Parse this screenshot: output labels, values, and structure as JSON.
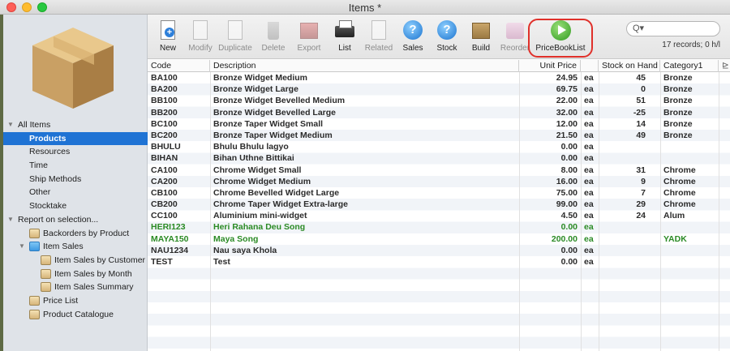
{
  "window": {
    "title": "Items *"
  },
  "sidebar": {
    "items": [
      {
        "label": "All Items",
        "level": 0,
        "tri": "▼",
        "selected": false
      },
      {
        "label": "Products",
        "level": 1,
        "selected": true
      },
      {
        "label": "Resources",
        "level": 1,
        "selected": false
      },
      {
        "label": "Time",
        "level": 1,
        "selected": false
      },
      {
        "label": "Ship Methods",
        "level": 1,
        "selected": false
      },
      {
        "label": "Other",
        "level": 1,
        "selected": false
      },
      {
        "label": "Stocktake",
        "level": 1,
        "selected": false
      },
      {
        "label": "Report on selection...",
        "level": 0,
        "tri": "▼",
        "selected": false
      },
      {
        "label": "Backorders by Product",
        "level": 1,
        "icon": "report-icon"
      },
      {
        "label": "Item Sales",
        "level": 1,
        "tri": "▼",
        "icon": "folder-icon"
      },
      {
        "label": "Item Sales by Customer",
        "level": 2,
        "icon": "report-icon"
      },
      {
        "label": "Item Sales by Month",
        "level": 2,
        "icon": "report-icon"
      },
      {
        "label": "Item Sales Summary",
        "level": 2,
        "icon": "report-icon"
      },
      {
        "label": "Price List",
        "level": 1,
        "icon": "report-icon"
      },
      {
        "label": "Product Catalogue",
        "level": 1,
        "icon": "report-icon"
      }
    ]
  },
  "toolbar": {
    "buttons": [
      {
        "id": "new",
        "label": "New",
        "icon": "new-doc-icon",
        "enabled": true
      },
      {
        "id": "modify",
        "label": "Modify",
        "icon": "pencil-icon",
        "enabled": false
      },
      {
        "id": "duplicate",
        "label": "Duplicate",
        "icon": "duplicate-icon",
        "enabled": false
      },
      {
        "id": "delete",
        "label": "Delete",
        "icon": "trash-icon",
        "enabled": false
      },
      {
        "id": "export",
        "label": "Export",
        "icon": "export-icon",
        "enabled": false
      },
      {
        "id": "list",
        "label": "List",
        "icon": "printer-icon",
        "enabled": true
      },
      {
        "id": "related",
        "label": "Related",
        "icon": "related-icon",
        "enabled": false
      },
      {
        "id": "sales",
        "label": "Sales",
        "icon": "help-icon",
        "enabled": true
      },
      {
        "id": "stock",
        "label": "Stock",
        "icon": "help-icon",
        "enabled": true
      },
      {
        "id": "build",
        "label": "Build",
        "icon": "build-icon",
        "enabled": true
      },
      {
        "id": "reorder",
        "label": "Reorder",
        "icon": "reorder-icon",
        "enabled": false
      },
      {
        "id": "pricebooklist",
        "label": "PriceBookList",
        "icon": "play-icon",
        "enabled": true
      }
    ],
    "search_placeholder": "",
    "search_prefix": "Q▾",
    "records": "17 records; 0 h/l",
    "highlight_color": "#e0302a"
  },
  "table": {
    "columns": [
      "Code",
      "Description",
      "Unit Price",
      "",
      "Stock on Hand",
      "Category1"
    ],
    "rows": [
      {
        "code": "BA100",
        "desc": "Bronze Widget Medium",
        "price": "24.95",
        "unit": "ea",
        "stock": "45",
        "cat": "Bronze"
      },
      {
        "code": "BA200",
        "desc": "Bronze Widget Large",
        "price": "69.75",
        "unit": "ea",
        "stock": "0",
        "cat": "Bronze"
      },
      {
        "code": "BB100",
        "desc": "Bronze Widget Bevelled Medium",
        "price": "22.00",
        "unit": "ea",
        "stock": "51",
        "cat": "Bronze"
      },
      {
        "code": "BB200",
        "desc": "Bronze Widget Bevelled Large",
        "price": "32.00",
        "unit": "ea",
        "stock": "-25",
        "cat": "Bronze"
      },
      {
        "code": "BC100",
        "desc": "Bronze Taper Widget Small",
        "price": "12.00",
        "unit": "ea",
        "stock": "14",
        "cat": "Bronze"
      },
      {
        "code": "BC200",
        "desc": "Bronze Taper Widget Medium",
        "price": "21.50",
        "unit": "ea",
        "stock": "49",
        "cat": "Bronze"
      },
      {
        "code": "BHULU",
        "desc": "Bhulu Bhulu lagyo",
        "price": "0.00",
        "unit": "ea",
        "stock": "",
        "cat": ""
      },
      {
        "code": "BIHAN",
        "desc": "Bihan Uthne Bittikai",
        "price": "0.00",
        "unit": "ea",
        "stock": "",
        "cat": ""
      },
      {
        "code": "CA100",
        "desc": "Chrome Widget Small",
        "price": "8.00",
        "unit": "ea",
        "stock": "31",
        "cat": "Chrome"
      },
      {
        "code": "CA200",
        "desc": "Chrome Widget Medium",
        "price": "16.00",
        "unit": "ea",
        "stock": "9",
        "cat": "Chrome"
      },
      {
        "code": "CB100",
        "desc": "Chrome Bevelled Widget Large",
        "price": "75.00",
        "unit": "ea",
        "stock": "7",
        "cat": "Chrome"
      },
      {
        "code": "CB200",
        "desc": "Chrome Taper Widget Extra-large",
        "price": "99.00",
        "unit": "ea",
        "stock": "29",
        "cat": "Chrome"
      },
      {
        "code": "CC100",
        "desc": "Aluminium mini-widget",
        "price": "4.50",
        "unit": "ea",
        "stock": "24",
        "cat": "Alum"
      },
      {
        "code": "HERI123",
        "desc": "Heri Rahana Deu Song",
        "price": "0.00",
        "unit": "ea",
        "stock": "",
        "cat": "",
        "green": true
      },
      {
        "code": "MAYA150",
        "desc": "Maya Song",
        "price": "200.00",
        "unit": "ea",
        "stock": "",
        "cat": "YADK",
        "green": true
      },
      {
        "code": "NAU1234",
        "desc": "Nau saya Khola",
        "price": "0.00",
        "unit": "ea",
        "stock": "",
        "cat": ""
      },
      {
        "code": "TEST",
        "desc": "Test",
        "price": "0.00",
        "unit": "ea",
        "stock": "",
        "cat": ""
      }
    ]
  }
}
